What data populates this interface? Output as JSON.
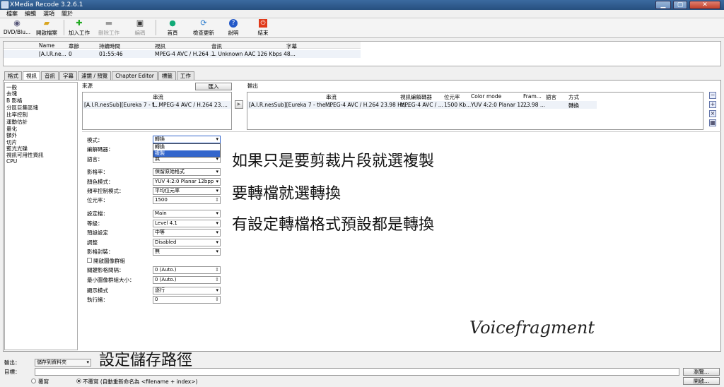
{
  "window": {
    "title": "XMedia Recode 3.2.6.1",
    "min": "▁",
    "max": "▢",
    "close": "✕"
  },
  "menu": [
    "檔案",
    "編輯",
    "選項",
    "關於"
  ],
  "toolbar": {
    "dvd": "DVD/Blu...",
    "open": "開啟檔案",
    "add": "加入工作",
    "remove": "刪除工作",
    "encode": "編碼",
    "home": "首頁",
    "update": "檢查更新",
    "help": "說明",
    "exit": "結束"
  },
  "filelist": {
    "headers": [
      "Name",
      "章節",
      "持續時間",
      "視訊",
      "音訊",
      "字幕"
    ],
    "row": [
      "[A.I.R.ne...",
      "0",
      "01:55:46",
      "MPEG-4 AVC / H.264 ...",
      "1. Unknown AAC  126 Kbps 48..."
    ]
  },
  "tabs": [
    "格式",
    "視訊",
    "音訊",
    "字幕",
    "濾鏡 / 預覽",
    "Chapter Editor",
    "標籤",
    "工作"
  ],
  "categories": [
    "一般",
    "去塊",
    "B 影格",
    "分區巨集區塊",
    "比率控制",
    "運動估計",
    "量化",
    "額外",
    "切片",
    "藍光光碟",
    "視訊可用性資訊",
    "CPU"
  ],
  "source": {
    "label": "來源",
    "button": "匯入",
    "col": "串流",
    "name": "[A.I.R.nesSub][Eureka 7 - t...",
    "stream": "1. MPEG-4 AVC / H.264 23...."
  },
  "output": {
    "label": "輸出",
    "cols": [
      "串流",
      "視訊編解碼器",
      "位元率",
      "Color mode",
      "Fram...",
      "語言",
      "方式"
    ],
    "row": [
      "[A.I.R.nesSub][Eureka 7 - the ...",
      "MPEG-4 AVC / H.264 23.98 Hz,...",
      "MPEG-4 AVC / ...",
      "1500 Kb...",
      "YUV 4:2:0 Planar 12...",
      "23.98 ...",
      "",
      "轉換"
    ]
  },
  "settings": {
    "mode": {
      "label": "模式：",
      "value": "轉換",
      "options": [
        "轉換",
        "複製"
      ]
    },
    "codec": {
      "label": "編解碼器："
    },
    "lang": {
      "label": "語言：",
      "value": "無"
    },
    "framerate": {
      "label": "影格率：",
      "value": "保留原始格式"
    },
    "colormode": {
      "label": "顏色模式：",
      "value": "YUV 4:2:0 Planar 12bpp"
    },
    "ratecontrol": {
      "label": "頻率控制模式：",
      "value": "平均位元率"
    },
    "bitrate": {
      "label": "位元率：",
      "value": "1500"
    },
    "profile": {
      "label": "設定檔：",
      "value": "Main"
    },
    "level": {
      "label": "等級：",
      "value": "Level 4.1"
    },
    "preset": {
      "label": "預設設定",
      "value": "中等"
    },
    "tune": {
      "label": "調整",
      "value": "Disabled"
    },
    "encap": {
      "label": "影格封裝：",
      "value": "無"
    },
    "opengop": {
      "label": "開啟圖像群組"
    },
    "keyint": {
      "label": "關鍵影格間隔：",
      "value": "0 (Auto.)"
    },
    "mingop": {
      "label": "最小圖像群組大小：",
      "value": "0 (Auto.)"
    },
    "display": {
      "label": "顯示模式",
      "value": "逐行"
    },
    "threads": {
      "label": "執行緒：",
      "value": "0"
    }
  },
  "annotations": {
    "line1": "如果只是要剪裁片段就選複製",
    "line2": "要轉檔就選轉換",
    "line3": "有設定轉檔格式預設都是轉換",
    "save": "設定儲存路徑",
    "watermark": "Voicefragment"
  },
  "bottom": {
    "output_label": "輸出：",
    "output_value": "儲存到資料夾",
    "target_label": "目標：",
    "browse": "瀏覽...",
    "open": "開啟...",
    "overwrite": "覆寫",
    "no_overwrite": "不覆寫 (自動重新命名為 <filename + index>)"
  }
}
